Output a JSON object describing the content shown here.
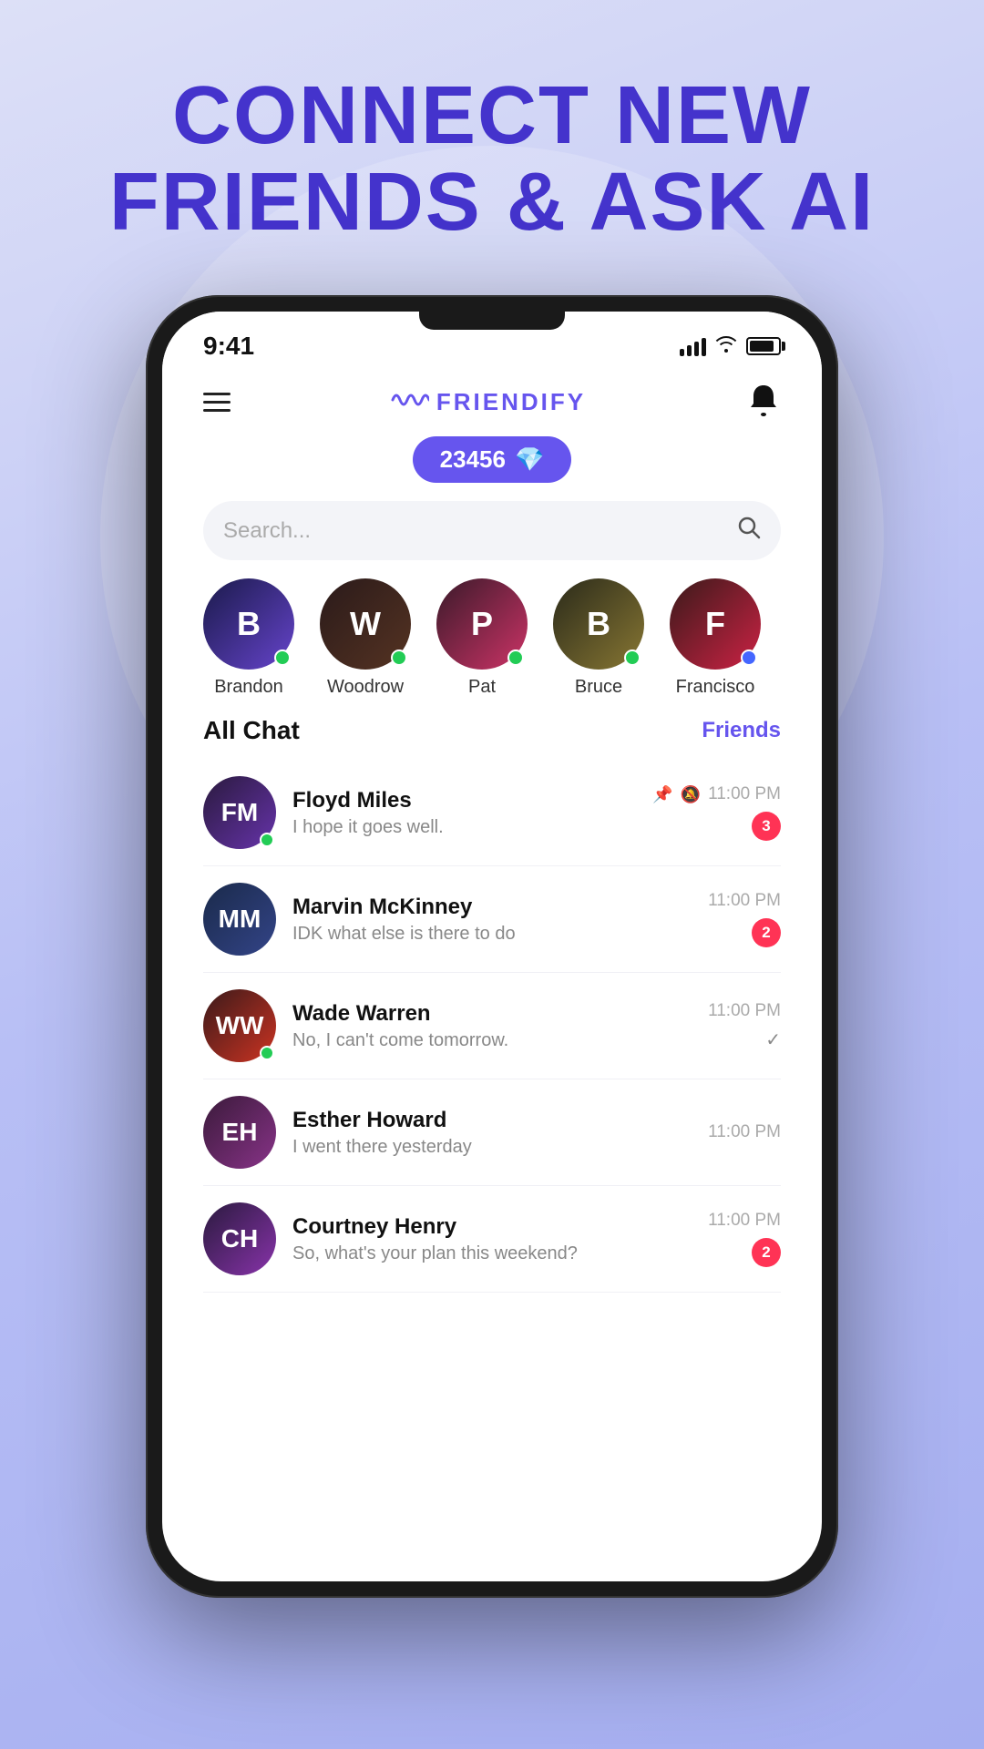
{
  "background": {
    "gradient_start": "#dde0f7",
    "gradient_end": "#a5aef0"
  },
  "hero": {
    "title_line1": "CONNECT NEW",
    "title_line2": "FRIENDS & ASK AI"
  },
  "status_bar": {
    "time": "9:41",
    "battery_label": "battery"
  },
  "app_header": {
    "logo_text": "FRIENDIFY",
    "menu_label": "Menu",
    "bell_label": "Notifications"
  },
  "points_badge": {
    "points": "23456",
    "diamond_icon": "💎"
  },
  "search": {
    "placeholder": "Search..."
  },
  "stories": [
    {
      "name": "Brandon",
      "online": "green",
      "initials": "B"
    },
    {
      "name": "Woodrow",
      "online": "green",
      "initials": "W"
    },
    {
      "name": "Pat",
      "online": "green",
      "initials": "P"
    },
    {
      "name": "Bruce",
      "online": "green",
      "initials": "B"
    },
    {
      "name": "Francisco",
      "online": "blue",
      "initials": "F"
    }
  ],
  "chat_section": {
    "title": "All Chat",
    "friends_link": "Friends"
  },
  "chats": [
    {
      "name": "Floyd Miles",
      "preview": "I hope it goes well.",
      "time": "11:00 PM",
      "unread": 3,
      "pinned": true,
      "muted": true,
      "online": true,
      "av_class": "av-floyd",
      "initials": "FM"
    },
    {
      "name": "Marvin McKinney",
      "preview": "IDK what else is there to do",
      "time": "11:00 PM",
      "unread": 2,
      "pinned": false,
      "muted": false,
      "online": false,
      "av_class": "av-marvin",
      "initials": "MM"
    },
    {
      "name": "Wade Warren",
      "preview": "No, I can't come tomorrow.",
      "time": "11:00 PM",
      "unread": 0,
      "read": true,
      "pinned": false,
      "muted": false,
      "online": true,
      "av_class": "av-wade",
      "initials": "WW"
    },
    {
      "name": "Esther Howard",
      "preview": "I went there yesterday",
      "time": "11:00 PM",
      "unread": 0,
      "read": false,
      "pinned": false,
      "muted": false,
      "online": false,
      "av_class": "av-esther",
      "initials": "EH"
    },
    {
      "name": "Courtney Henry",
      "preview": "So, what's your plan this weekend?",
      "time": "11:00 PM",
      "unread": 2,
      "pinned": false,
      "muted": false,
      "online": false,
      "av_class": "av-courtney",
      "initials": "CH"
    }
  ]
}
